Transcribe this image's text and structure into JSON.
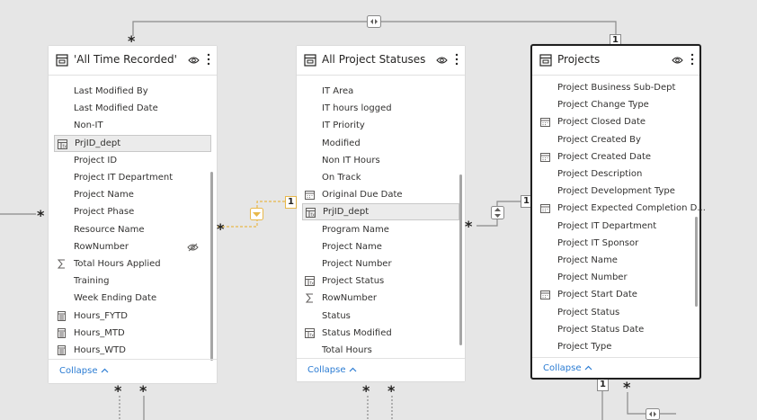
{
  "tables": {
    "all_time_recorded": {
      "title": "'All Time Recorded'",
      "fields": [
        {
          "label": "Last Modified By",
          "icon": "none"
        },
        {
          "label": "Last Modified Date",
          "icon": "none"
        },
        {
          "label": "Non-IT",
          "icon": "none"
        },
        {
          "label": "PrjID_dept",
          "icon": "calculated-column-icon",
          "selected": true
        },
        {
          "label": "Project ID",
          "icon": "none"
        },
        {
          "label": "Project IT Department",
          "icon": "none"
        },
        {
          "label": "Project Name",
          "icon": "none"
        },
        {
          "label": "Project Phase",
          "icon": "none"
        },
        {
          "label": "Resource Name",
          "icon": "none"
        },
        {
          "label": "RowNumber",
          "icon": "none",
          "hidden": true
        },
        {
          "label": "Total Hours Applied",
          "icon": "sigma-icon"
        },
        {
          "label": "Training",
          "icon": "none"
        },
        {
          "label": "Week Ending Date",
          "icon": "none"
        },
        {
          "label": "Hours_FYTD",
          "icon": "measure-icon"
        },
        {
          "label": "Hours_MTD",
          "icon": "measure-icon"
        },
        {
          "label": "Hours_WTD",
          "icon": "measure-icon"
        }
      ],
      "collapse_label": "Collapse"
    },
    "all_project_statuses": {
      "title": "All Project Statuses",
      "fields": [
        {
          "label": "IT Area",
          "icon": "none"
        },
        {
          "label": "IT hours logged",
          "icon": "none"
        },
        {
          "label": "IT Priority",
          "icon": "none"
        },
        {
          "label": "Modified",
          "icon": "none"
        },
        {
          "label": "Non IT Hours",
          "icon": "none"
        },
        {
          "label": "On Track",
          "icon": "none"
        },
        {
          "label": "Original Due Date",
          "icon": "calendar-icon"
        },
        {
          "label": "PrjID_dept",
          "icon": "calculated-column-icon",
          "selected": true
        },
        {
          "label": "Program Name",
          "icon": "none"
        },
        {
          "label": "Project Name",
          "icon": "none"
        },
        {
          "label": "Project Number",
          "icon": "none"
        },
        {
          "label": "Project Status",
          "icon": "calculated-column-icon"
        },
        {
          "label": "RowNumber",
          "icon": "sigma-icon"
        },
        {
          "label": "Status",
          "icon": "none"
        },
        {
          "label": "Status Modified",
          "icon": "calculated-column-icon"
        },
        {
          "label": "Total Hours",
          "icon": "none"
        }
      ],
      "collapse_label": "Collapse"
    },
    "projects": {
      "title": "Projects",
      "fields": [
        {
          "label": "Project Business Sub-Dept",
          "icon": "none"
        },
        {
          "label": "Project Change Type",
          "icon": "none"
        },
        {
          "label": "Project Closed Date",
          "icon": "calendar-icon"
        },
        {
          "label": "Project Created By",
          "icon": "none"
        },
        {
          "label": "Project Created Date",
          "icon": "calendar-icon"
        },
        {
          "label": "Project Description",
          "icon": "none"
        },
        {
          "label": "Project Development Type",
          "icon": "none"
        },
        {
          "label": "Project Expected Completion D...",
          "icon": "calendar-icon"
        },
        {
          "label": "Project IT Department",
          "icon": "none"
        },
        {
          "label": "Project IT Sponsor",
          "icon": "none"
        },
        {
          "label": "Project Name",
          "icon": "none"
        },
        {
          "label": "Project Number",
          "icon": "none"
        },
        {
          "label": "Project Start Date",
          "icon": "calendar-icon"
        },
        {
          "label": "Project Status",
          "icon": "none"
        },
        {
          "label": "Project Status Date",
          "icon": "none"
        },
        {
          "label": "Project Type",
          "icon": "none"
        }
      ],
      "collapse_label": "Collapse"
    }
  },
  "relationships": {
    "top_many": "*",
    "top_one": "1",
    "mid_left_many": "*",
    "mid_right_one": "1",
    "mid_left2_many": "*",
    "proj_one": "1",
    "bottom_many_1": "*",
    "bottom_many_2": "*",
    "bottom_many_3": "*",
    "bottom_many_4": "*",
    "bottom_one": "1",
    "bottom_many_5": "*",
    "left_edge_many": "*"
  },
  "colors": {
    "canvas": "#e6e6e6",
    "line": "#8a8a8a",
    "active_line": "#e8b84a",
    "link": "#2b7cd3"
  }
}
